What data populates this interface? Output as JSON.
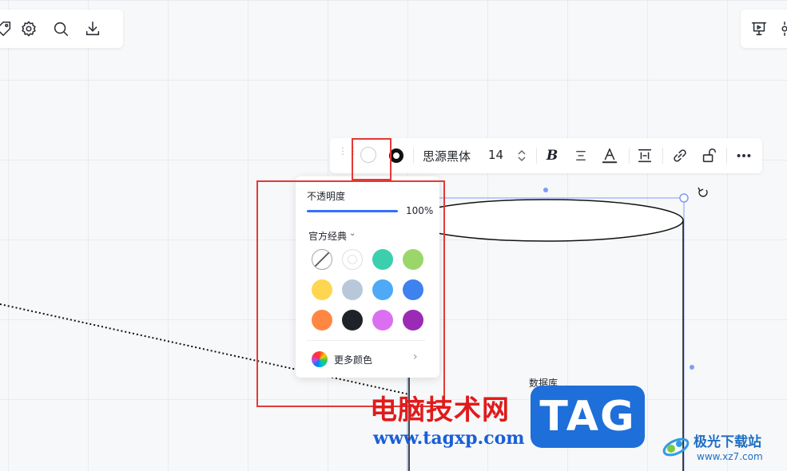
{
  "toolbar_left": {
    "icons": [
      "tag-icon",
      "gear-icon",
      "search-icon",
      "download-icon"
    ]
  },
  "toolbar_right": {
    "icons": [
      "present-icon",
      "more-icon"
    ]
  },
  "format_bar": {
    "font_name": "思源黑体",
    "font_size": "14",
    "bold_label": "B"
  },
  "fill_popup": {
    "opacity_label": "不透明度",
    "opacity_value": "100%",
    "opacity_fraction": 1.0,
    "palette_name": "官方经典",
    "swatches": [
      [
        "none",
        "#ffffff",
        "#3ccfae",
        "#9bd66b"
      ],
      [
        "#ffd652",
        "#b8c7d9",
        "#4ea9f7",
        "#3d82ee"
      ],
      [
        "#ff8743",
        "#1f2329",
        "#dc6ff1",
        "#9b2bb4"
      ]
    ],
    "more_colors_label": "更多颜色"
  },
  "canvas": {
    "node_label": "数据库",
    "shape": "cylinder"
  },
  "colors": {
    "accent": "#3370ff",
    "highlight": "#e53935",
    "selection": "#7f9cf5"
  },
  "watermark": {
    "cn_text": "电脑技术网",
    "url": "www.tagxp.com",
    "tag": "TAG",
    "site_name": "极光下载站",
    "site_url": "www.xz7.com"
  }
}
